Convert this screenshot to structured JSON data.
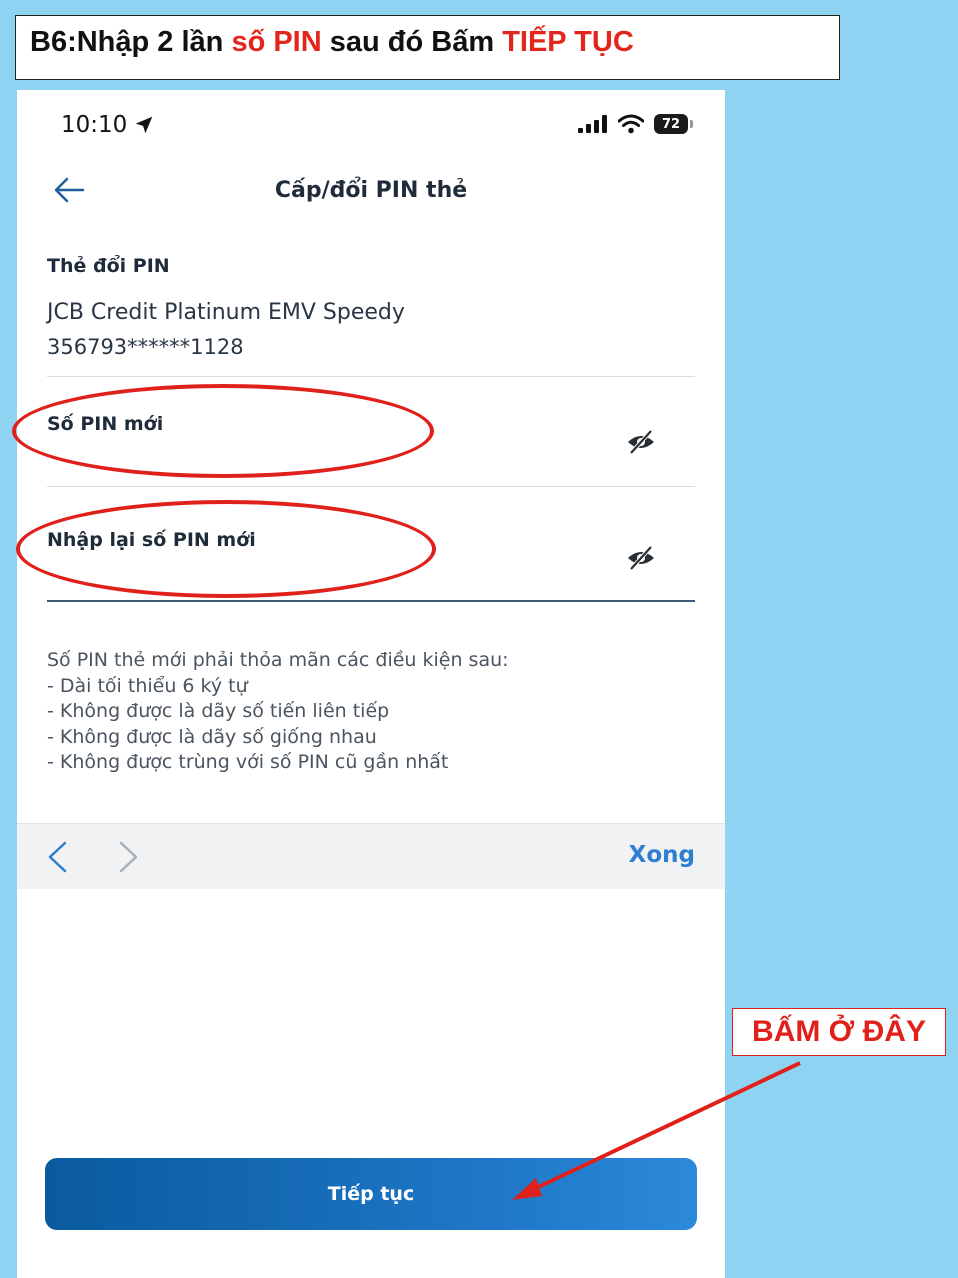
{
  "banner": {
    "part1": "B6:Nhập 2 lần ",
    "part2": "số PIN",
    "part3": " sau đó Bấm ",
    "part4": "TIẾP TỤC"
  },
  "status_bar": {
    "time": "10:10",
    "battery": "72",
    "icons": [
      "location-arrow-icon",
      "signal-icon",
      "wifi-icon",
      "battery-icon"
    ]
  },
  "nav": {
    "title": "Cấp/đổi PIN thẻ",
    "back_icon": "back-arrow-icon"
  },
  "card": {
    "label": "Thẻ đổi PIN",
    "name": "JCB Credit Platinum EMV Speedy",
    "number": "356793******1128"
  },
  "fields": {
    "new_pin_label": "Số PIN mới",
    "confirm_pin_label": "Nhập lại số PIN mới"
  },
  "rules": [
    "Số PIN thẻ mới phải thỏa mãn các điều kiện sau:",
    "- Dài tối thiểu 6 ký tự",
    "- Không được là dãy số tiến liên tiếp",
    "- Không được là dãy số giống nhau",
    "- Không được trùng với số PIN cũ gần nhất"
  ],
  "keyboard_bar": {
    "done_label": "Xong"
  },
  "continue_button": "Tiếp tục",
  "callout": "BẤM Ở ĐÂY",
  "colors": {
    "background": "#8fd3f3",
    "highlight_red": "#e0211b",
    "accent_blue": "#2f7fd1",
    "button_blue": "#0a5a9e"
  }
}
